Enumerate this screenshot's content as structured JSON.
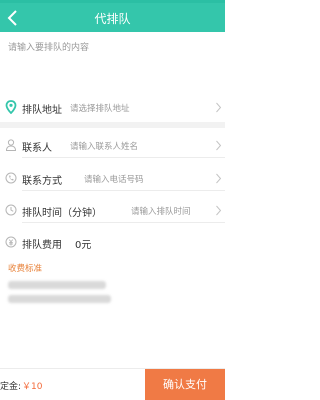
{
  "header": {
    "title": "代排队"
  },
  "content_placeholder": "请输入要排队的内容",
  "fields": {
    "address": {
      "label": "排队地址",
      "placeholder": "请选择排队地址"
    },
    "contact": {
      "label": "联系人",
      "placeholder": "请输入联系人姓名"
    },
    "phone": {
      "label": "联系方式",
      "placeholder": "请输入电话号码"
    },
    "time": {
      "label": "排队时间（分钟）",
      "placeholder": "请输入排队时间"
    },
    "fee": {
      "label": "排队费用",
      "value": "0元"
    }
  },
  "fee_standard": {
    "title": "收费标准"
  },
  "footer": {
    "deposit_label": "定金:",
    "deposit_value": "￥10",
    "confirm_label": "确认支付"
  },
  "colors": {
    "brand": "#34c6ab",
    "accent": "#f07a45",
    "fee_title": "#e8823a"
  }
}
